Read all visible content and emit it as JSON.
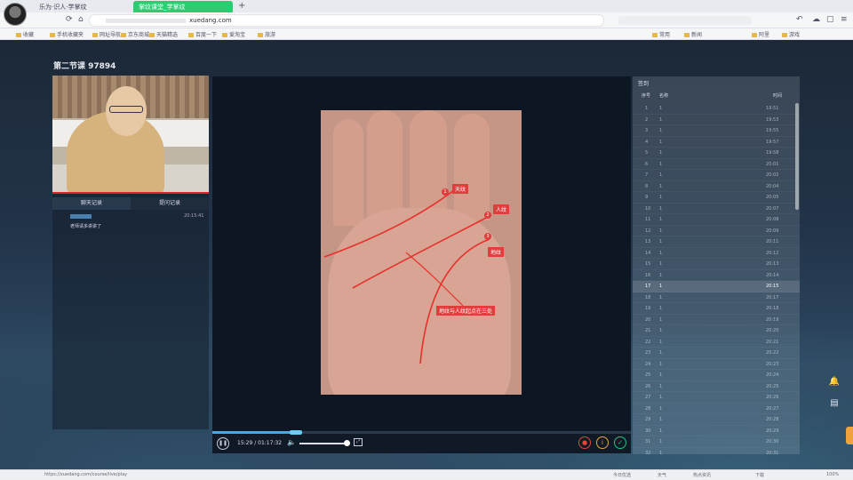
{
  "browser": {
    "tabs": [
      {
        "label": "乐为·识人·学掌纹"
      },
      {
        "label": "掌纹课堂_学掌纹"
      }
    ],
    "address": "xuedang.com",
    "bookmarks": [
      "收藏",
      "手机收藏夹",
      "网址导航",
      "京东商城",
      "天猫精选",
      "百度一下",
      "爱淘宝",
      "旅游",
      "常用",
      "新闻",
      "阿里",
      "游戏"
    ]
  },
  "page": {
    "title": "第二节课 97894"
  },
  "left_panel": {
    "tabs": [
      "聊天记录",
      "提问记录"
    ],
    "chat": {
      "time": "20:15:41",
      "message": "老师请多讲讲了"
    }
  },
  "slide": {
    "labels": {
      "tian": "天纹",
      "ren": "人纹",
      "di": "地纹",
      "note": "地纹与人纹起点在三处"
    },
    "numbers": [
      "1",
      "2",
      "3"
    ]
  },
  "player": {
    "time_display": "15:29 / 01:17:32",
    "progress": 0.2,
    "volume": 0.95,
    "icons": [
      "pause-icon",
      "volume-icon",
      "fullscreen-icon",
      "rec-icon",
      "info-icon",
      "check-icon"
    ]
  },
  "right_panel": {
    "title": "签到",
    "headers": [
      "序号",
      "名称",
      "时间"
    ],
    "rows": [
      {
        "no": "1",
        "name": "1",
        "time": "19:51"
      },
      {
        "no": "2",
        "name": "1",
        "time": "19:53"
      },
      {
        "no": "3",
        "name": "1",
        "time": "19:55"
      },
      {
        "no": "4",
        "name": "1",
        "time": "19:57"
      },
      {
        "no": "5",
        "name": "1",
        "time": "19:58"
      },
      {
        "no": "6",
        "name": "1",
        "time": "20:01"
      },
      {
        "no": "7",
        "name": "1",
        "time": "20:02"
      },
      {
        "no": "8",
        "name": "1",
        "time": "20:04"
      },
      {
        "no": "9",
        "name": "1",
        "time": "20:05"
      },
      {
        "no": "10",
        "name": "1",
        "time": "20:07"
      },
      {
        "no": "11",
        "name": "1",
        "time": "20:08"
      },
      {
        "no": "12",
        "name": "1",
        "time": "20:09"
      },
      {
        "no": "13",
        "name": "1",
        "time": "20:11"
      },
      {
        "no": "14",
        "name": "1",
        "time": "20:12"
      },
      {
        "no": "15",
        "name": "1",
        "time": "20:13"
      },
      {
        "no": "16",
        "name": "1",
        "time": "20:14"
      },
      {
        "no": "17",
        "name": "1",
        "time": "20:15"
      },
      {
        "no": "18",
        "name": "1",
        "time": "20:17"
      },
      {
        "no": "19",
        "name": "1",
        "time": "20:18"
      },
      {
        "no": "20",
        "name": "1",
        "time": "20:19"
      },
      {
        "no": "21",
        "name": "1",
        "time": "20:20"
      },
      {
        "no": "22",
        "name": "1",
        "time": "20:21"
      },
      {
        "no": "23",
        "name": "1",
        "time": "20:22"
      },
      {
        "no": "24",
        "name": "1",
        "time": "20:23"
      },
      {
        "no": "25",
        "name": "1",
        "time": "20:24"
      },
      {
        "no": "26",
        "name": "1",
        "time": "20:25"
      },
      {
        "no": "27",
        "name": "1",
        "time": "20:26"
      },
      {
        "no": "28",
        "name": "1",
        "time": "20:27"
      },
      {
        "no": "29",
        "name": "1",
        "time": "20:28"
      },
      {
        "no": "30",
        "name": "1",
        "time": "20:29"
      },
      {
        "no": "31",
        "name": "1",
        "time": "20:30"
      },
      {
        "no": "32",
        "name": "1",
        "time": "20:31"
      }
    ]
  },
  "status_bar": {
    "url": "https://xuedang.com/course/live/play",
    "items": [
      "今日优选",
      "天气",
      "热点资讯",
      "下载",
      "100%"
    ]
  }
}
